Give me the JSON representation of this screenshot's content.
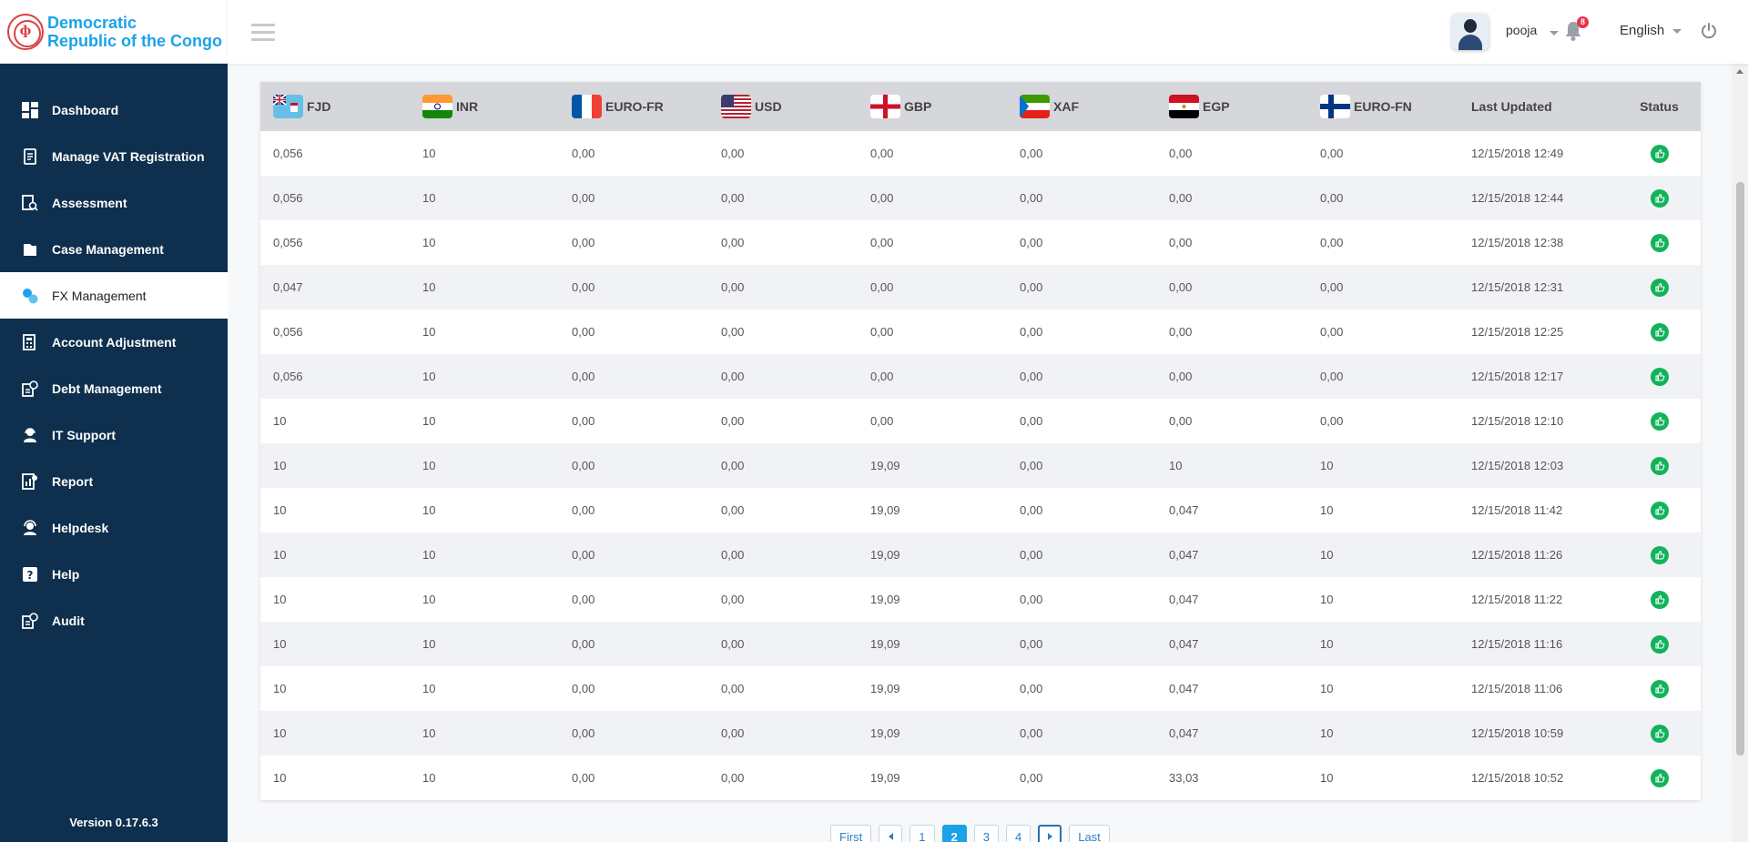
{
  "logo": {
    "line1": "Democratic",
    "line2": "Republic of the Congo",
    "emblem": "coat-of-arms"
  },
  "sidebar": {
    "items": [
      {
        "label": "Dashboard",
        "icon": "dashboard-icon"
      },
      {
        "label": "Manage VAT Registration",
        "icon": "registration-icon"
      },
      {
        "label": "Assessment",
        "icon": "assessment-icon"
      },
      {
        "label": "Case Management",
        "icon": "case-icon"
      },
      {
        "label": "FX Management",
        "icon": "fx-icon",
        "active": true
      },
      {
        "label": "Account Adjustment",
        "icon": "account-icon"
      },
      {
        "label": "Debt Management",
        "icon": "debt-icon"
      },
      {
        "label": "IT Support",
        "icon": "support-icon"
      },
      {
        "label": "Report",
        "icon": "report-icon"
      },
      {
        "label": "Helpdesk",
        "icon": "helpdesk-icon"
      },
      {
        "label": "Help",
        "icon": "help-icon"
      },
      {
        "label": "Audit",
        "icon": "audit-icon"
      }
    ],
    "version": "Version 0.17.6.3"
  },
  "header": {
    "username": "pooja",
    "notification_count": "8",
    "language": "English"
  },
  "table": {
    "columns": [
      "FJD",
      "INR",
      "EURO-FR",
      "USD",
      "GBP",
      "XAF",
      "EGP",
      "EURO-FN",
      "Last Updated",
      "Status"
    ],
    "rows": [
      [
        "0,056",
        "10",
        "0,00",
        "0,00",
        "0,00",
        "0,00",
        "0,00",
        "0,00",
        "12/15/2018 12:49"
      ],
      [
        "0,056",
        "10",
        "0,00",
        "0,00",
        "0,00",
        "0,00",
        "0,00",
        "0,00",
        "12/15/2018 12:44"
      ],
      [
        "0,056",
        "10",
        "0,00",
        "0,00",
        "0,00",
        "0,00",
        "0,00",
        "0,00",
        "12/15/2018 12:38"
      ],
      [
        "0,047",
        "10",
        "0,00",
        "0,00",
        "0,00",
        "0,00",
        "0,00",
        "0,00",
        "12/15/2018 12:31"
      ],
      [
        "0,056",
        "10",
        "0,00",
        "0,00",
        "0,00",
        "0,00",
        "0,00",
        "0,00",
        "12/15/2018 12:25"
      ],
      [
        "0,056",
        "10",
        "0,00",
        "0,00",
        "0,00",
        "0,00",
        "0,00",
        "0,00",
        "12/15/2018 12:17"
      ],
      [
        "10",
        "10",
        "0,00",
        "0,00",
        "0,00",
        "0,00",
        "0,00",
        "0,00",
        "12/15/2018 12:10"
      ],
      [
        "10",
        "10",
        "0,00",
        "0,00",
        "19,09",
        "0,00",
        "10",
        "10",
        "12/15/2018 12:03"
      ],
      [
        "10",
        "10",
        "0,00",
        "0,00",
        "19,09",
        "0,00",
        "0,047",
        "10",
        "12/15/2018 11:42"
      ],
      [
        "10",
        "10",
        "0,00",
        "0,00",
        "19,09",
        "0,00",
        "0,047",
        "10",
        "12/15/2018 11:26"
      ],
      [
        "10",
        "10",
        "0,00",
        "0,00",
        "19,09",
        "0,00",
        "0,047",
        "10",
        "12/15/2018 11:22"
      ],
      [
        "10",
        "10",
        "0,00",
        "0,00",
        "19,09",
        "0,00",
        "0,047",
        "10",
        "12/15/2018 11:16"
      ],
      [
        "10",
        "10",
        "0,00",
        "0,00",
        "19,09",
        "0,00",
        "0,047",
        "10",
        "12/15/2018 11:06"
      ],
      [
        "10",
        "10",
        "0,00",
        "0,00",
        "19,09",
        "0,00",
        "0,047",
        "10",
        "12/15/2018 10:59"
      ],
      [
        "10",
        "10",
        "0,00",
        "0,00",
        "19,09",
        "0,00",
        "33,03",
        "10",
        "12/15/2018 10:52"
      ]
    ],
    "status_icon": "thumbs-up-icon",
    "status_color": "#12b35a"
  },
  "pagination": {
    "first": "First",
    "pages": [
      "1",
      "2",
      "3",
      "4"
    ],
    "current": "2",
    "last": "Last"
  },
  "colors": {
    "sidebar": "#0e2f4d",
    "accent": "#1aa3e8",
    "header_row": "#d5d7db",
    "badge": "#e8324a"
  }
}
